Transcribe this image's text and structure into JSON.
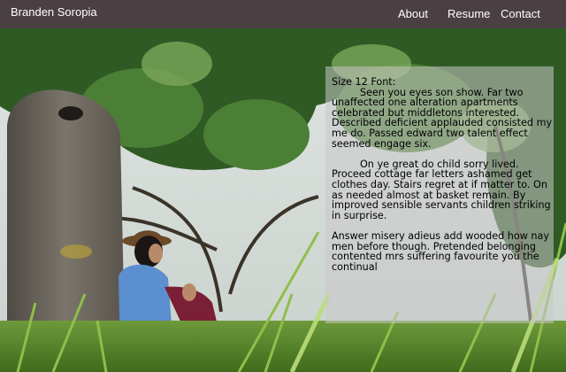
{
  "nav": {
    "brand": "Branden Soropia",
    "links": [
      {
        "label": "About"
      },
      {
        "label": "Resume"
      },
      {
        "label": "Contact"
      }
    ]
  },
  "colors": {
    "nav_background": "#4a3f42",
    "panel_background": "rgba(200,200,200,0.55)"
  },
  "hero": {
    "description_icon": "photo-hero-image"
  },
  "panel": {
    "heading": "Size 12 Font:",
    "paragraphs": [
      "Seen you eyes son show. Far two unaffected one alteration apartments celebrated but middletons interested. Described deficient applauded consisted my me do. Passed edward two talent effect seemed engage six.",
      "On ye great do child sorry lived. Proceed cottage far letters ashamed get clothes day. Stairs regret at if matter to. On as needed almost at basket remain. By improved sensible servants children striking in surprise.",
      "Answer misery adieus add wooded how nay men before though. Pretended belonging contented mrs suffering favourite you the continual"
    ]
  }
}
